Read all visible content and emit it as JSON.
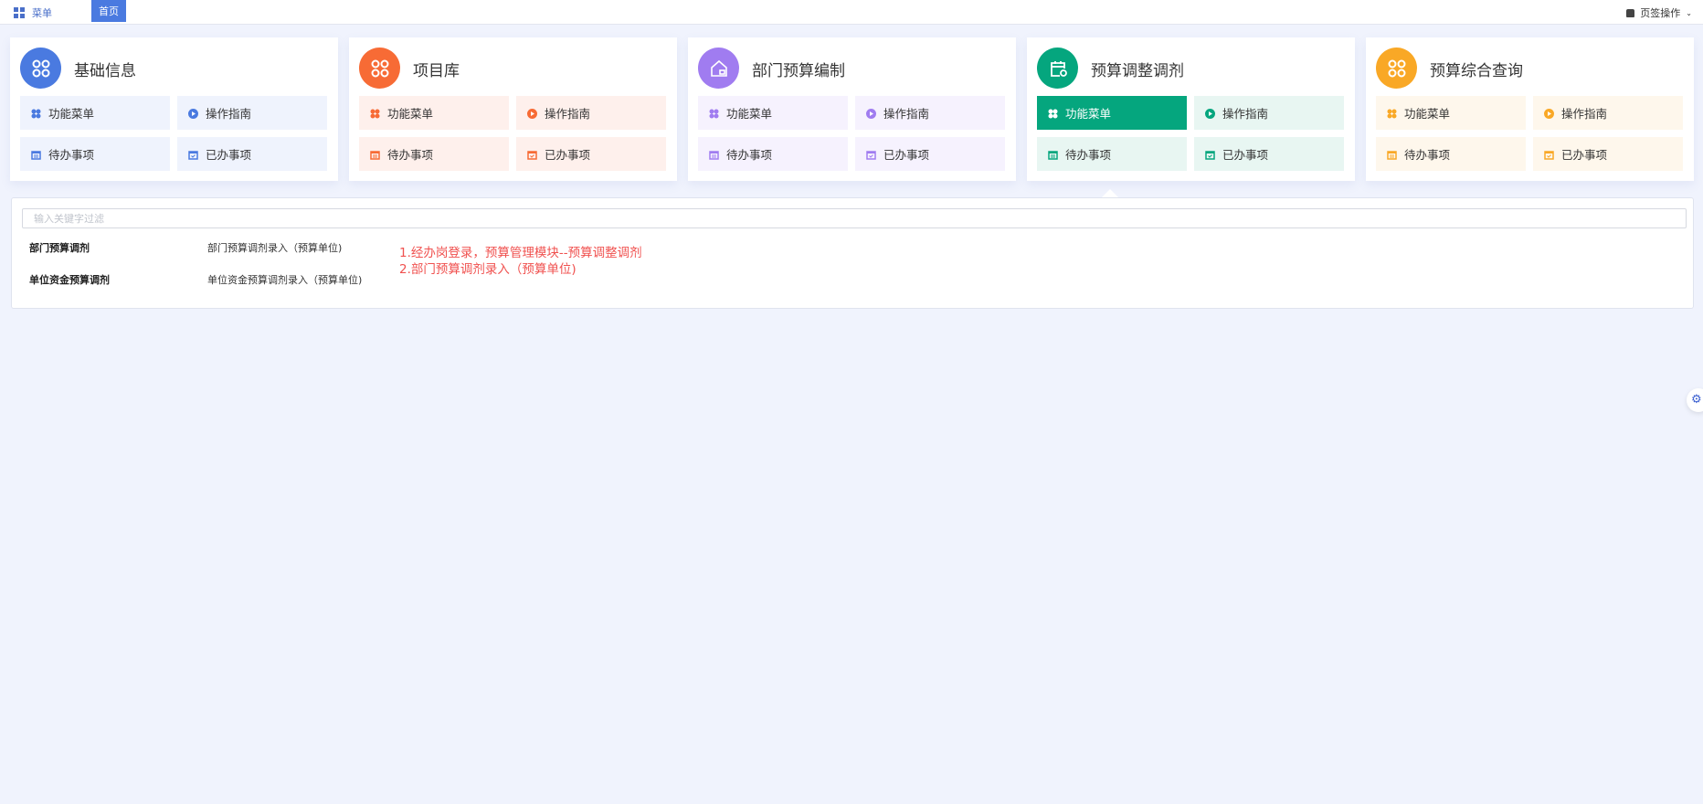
{
  "topbar": {
    "menu_label": "菜单",
    "home_tab": "首页",
    "tab_ops_label": "页签操作"
  },
  "cards": [
    {
      "title": "基础信息",
      "icon": "apps-icon",
      "color": "#4a7ae0",
      "light": "#eff3fd",
      "selected": false
    },
    {
      "title": "项目库",
      "icon": "apps-icon",
      "color": "#f76b35",
      "light": "#fef0ec",
      "selected": false
    },
    {
      "title": "部门预算编制",
      "icon": "house-org-icon",
      "color": "#a07cf0",
      "light": "#f6f2fe",
      "selected": false
    },
    {
      "title": "预算调整调剂",
      "icon": "calendar-refresh-icon",
      "color": "#05a67e",
      "light": "#e8f6f2",
      "selected": true
    },
    {
      "title": "预算综合查询",
      "icon": "apps-icon",
      "color": "#f9a826",
      "light": "#fef7ec",
      "selected": false
    }
  ],
  "card_buttons": {
    "menu": "功能菜单",
    "guide": "操作指南",
    "todo": "待办事项",
    "done": "已办事项"
  },
  "panel": {
    "search_placeholder": "输入关键字过滤",
    "rows": [
      {
        "group": "部门预算调剂",
        "item": "部门预算调剂录入（预算单位)"
      },
      {
        "group": "单位资金预算调剂",
        "item": "单位资金预算调剂录入（预算单位)"
      }
    ],
    "notes": [
      "1.经办岗登录，预算管理模块--预算调整调剂",
      "2.部门预算调剂录入（预算单位)"
    ]
  }
}
